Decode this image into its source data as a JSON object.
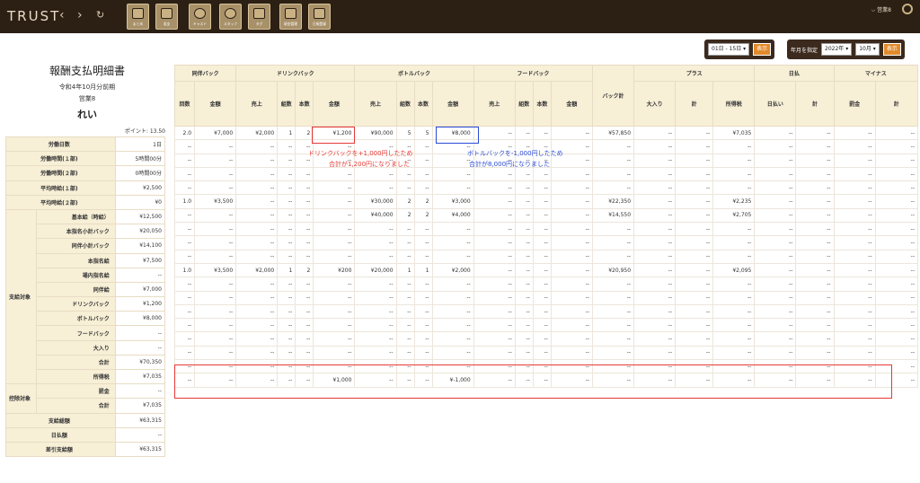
{
  "header": {
    "logo": "TRUST",
    "back": "‹",
    "forward": "›",
    "reload": "↻",
    "tools": [
      {
        "label": "まとめ",
        "icon": "clipboard-icon"
      },
      {
        "label": "収支",
        "icon": "bar-chart-icon"
      },
      {
        "label": "キャスト",
        "icon": "cast-user-icon"
      },
      {
        "label": "スタッフ",
        "icon": "staff-user-icon"
      },
      {
        "label": "タグ",
        "icon": "pencil-icon"
      },
      {
        "label": "現金管理",
        "icon": "cash-icon"
      },
      {
        "label": "日報登録",
        "icon": "calendar-icon"
      }
    ],
    "user": "営業8"
  },
  "controls": {
    "period": "01日 - 15日",
    "show1": "表示",
    "label": "年月を指定",
    "year": "2022年",
    "month": "10月",
    "show2": "表示"
  },
  "left": {
    "title": "報酬支払明細書",
    "period": "令和4年10月分前期",
    "dept": "営業8",
    "name": "れい",
    "points": "ポイント: 13.50",
    "rows": [
      {
        "group": "",
        "label": "労働日数",
        "value": "1日"
      },
      {
        "group": "",
        "label": "労働時間(１部)",
        "value": "5時間00分"
      },
      {
        "group": "",
        "label": "労働時間(２部)",
        "value": "0時間00分"
      },
      {
        "group": "",
        "label": "平均時給(１部)",
        "value": "¥2,500"
      },
      {
        "group": "",
        "label": "平均時給(２部)",
        "value": "¥0"
      },
      {
        "group": "",
        "label": "基本給（時給）",
        "value": "¥12,500"
      },
      {
        "group": "",
        "label": "本指名小計バック",
        "value": "¥20,050"
      },
      {
        "group": "",
        "label": "同伴小計バック",
        "value": "¥14,100"
      },
      {
        "group": "",
        "label": "本指名給",
        "value": "¥7,500"
      },
      {
        "group": "",
        "label": "場内指名給",
        "value": "--"
      },
      {
        "group": "支給対象",
        "label": "同伴給",
        "value": "¥7,000"
      },
      {
        "group": "",
        "label": "ドリンクバック",
        "value": "¥1,200"
      },
      {
        "group": "",
        "label": "ボトルバック",
        "value": "¥8,000"
      },
      {
        "group": "",
        "label": "フードバック",
        "value": "--"
      },
      {
        "group": "",
        "label": "大入り",
        "value": "--"
      },
      {
        "group": "",
        "label": "合計",
        "value": "¥70,350"
      },
      {
        "group": "",
        "label": "所得税",
        "value": "¥7,035"
      },
      {
        "group": "控除対象",
        "label": "罰金",
        "value": "--"
      },
      {
        "group": "",
        "label": "合計",
        "value": "¥7,035"
      },
      {
        "group": "",
        "label": "支給総額",
        "value": "¥63,315"
      },
      {
        "group": "",
        "label": "日払額",
        "value": "--"
      },
      {
        "group": "",
        "label": "差引支給額",
        "value": "¥63,315"
      }
    ]
  },
  "table": {
    "groups": [
      "同伴バック",
      "ドリンクバック",
      "ボトルバック",
      "フードバック",
      "",
      "プラス",
      "日払",
      "マイナス"
    ],
    "columns": [
      "回数",
      "金額",
      "売上",
      "組数",
      "本数",
      "金額",
      "売上",
      "組数",
      "本数",
      "金額",
      "売上",
      "組数",
      "本数",
      "金額",
      "バック計",
      "大入り",
      "計",
      "所得税",
      "日払い",
      "計",
      "罰金",
      "計"
    ],
    "rows": [
      [
        "2.0",
        "¥7,000",
        "¥2,000",
        "1",
        "2",
        "¥1,200",
        "¥90,000",
        "5",
        "5",
        "¥8,000",
        "--",
        "--",
        "--",
        "--",
        "¥57,850",
        "--",
        "--",
        "¥7,035",
        "--",
        "--",
        "--",
        "--"
      ],
      [
        "--",
        "--",
        "--",
        "--",
        "--",
        "--",
        "--",
        "--",
        "--",
        "--",
        "--",
        "--",
        "--",
        "--",
        "--",
        "--",
        "--",
        "--",
        "--",
        "--",
        "--",
        "--"
      ],
      [
        "--",
        "--",
        "--",
        "--",
        "--",
        "--",
        "--",
        "--",
        "--",
        "--",
        "--",
        "--",
        "--",
        "--",
        "--",
        "--",
        "--",
        "--",
        "--",
        "--",
        "--",
        "--"
      ],
      [
        "--",
        "--",
        "--",
        "--",
        "--",
        "--",
        "--",
        "--",
        "--",
        "--",
        "--",
        "--",
        "--",
        "--",
        "--",
        "--",
        "--",
        "--",
        "--",
        "--",
        "--",
        "--"
      ],
      [
        "--",
        "--",
        "--",
        "--",
        "--",
        "--",
        "--",
        "--",
        "--",
        "--",
        "--",
        "--",
        "--",
        "--",
        "--",
        "--",
        "--",
        "--",
        "--",
        "--",
        "--",
        "--"
      ],
      [
        "1.0",
        "¥3,500",
        "--",
        "--",
        "--",
        "--",
        "¥30,000",
        "2",
        "2",
        "¥3,000",
        "--",
        "--",
        "--",
        "--",
        "¥22,350",
        "--",
        "--",
        "¥2,235",
        "--",
        "--",
        "--",
        "--"
      ],
      [
        "--",
        "--",
        "--",
        "--",
        "--",
        "--",
        "¥40,000",
        "2",
        "2",
        "¥4,000",
        "--",
        "--",
        "--",
        "--",
        "¥14,550",
        "--",
        "--",
        "¥2,705",
        "--",
        "--",
        "--",
        "--"
      ],
      [
        "--",
        "--",
        "--",
        "--",
        "--",
        "--",
        "--",
        "--",
        "--",
        "--",
        "--",
        "--",
        "--",
        "--",
        "--",
        "--",
        "--",
        "--",
        "--",
        "--",
        "--",
        "--"
      ],
      [
        "--",
        "--",
        "--",
        "--",
        "--",
        "--",
        "--",
        "--",
        "--",
        "--",
        "--",
        "--",
        "--",
        "--",
        "--",
        "--",
        "--",
        "--",
        "--",
        "--",
        "--",
        "--"
      ],
      [
        "--",
        "--",
        "--",
        "--",
        "--",
        "--",
        "--",
        "--",
        "--",
        "--",
        "--",
        "--",
        "--",
        "--",
        "--",
        "--",
        "--",
        "--",
        "--",
        "--",
        "--",
        "--"
      ],
      [
        "1.0",
        "¥3,500",
        "¥2,000",
        "1",
        "2",
        "¥200",
        "¥20,000",
        "1",
        "1",
        "¥2,000",
        "--",
        "--",
        "--",
        "--",
        "¥20,950",
        "--",
        "--",
        "¥2,095",
        "--",
        "--",
        "--",
        "--"
      ],
      [
        "--",
        "--",
        "--",
        "--",
        "--",
        "--",
        "--",
        "--",
        "--",
        "--",
        "--",
        "--",
        "--",
        "--",
        "--",
        "--",
        "--",
        "--",
        "--",
        "--",
        "--",
        "--"
      ],
      [
        "--",
        "--",
        "--",
        "--",
        "--",
        "--",
        "--",
        "--",
        "--",
        "--",
        "--",
        "--",
        "--",
        "--",
        "--",
        "--",
        "--",
        "--",
        "--",
        "--",
        "--",
        "--"
      ],
      [
        "--",
        "--",
        "--",
        "--",
        "--",
        "--",
        "--",
        "--",
        "--",
        "--",
        "--",
        "--",
        "--",
        "--",
        "--",
        "--",
        "--",
        "--",
        "--",
        "--",
        "--",
        "--"
      ],
      [
        "--",
        "--",
        "--",
        "--",
        "--",
        "--",
        "--",
        "--",
        "--",
        "--",
        "--",
        "--",
        "--",
        "--",
        "--",
        "--",
        "--",
        "--",
        "--",
        "--",
        "--",
        "--"
      ],
      [
        "--",
        "--",
        "--",
        "--",
        "--",
        "--",
        "--",
        "--",
        "--",
        "--",
        "--",
        "--",
        "--",
        "--",
        "--",
        "--",
        "--",
        "--",
        "--",
        "--",
        "--",
        "--"
      ],
      [
        "--",
        "--",
        "--",
        "--",
        "--",
        "--",
        "--",
        "--",
        "--",
        "--",
        "--",
        "--",
        "--",
        "--",
        "--",
        "--",
        "--",
        "--",
        "--",
        "--",
        "--",
        "--"
      ],
      [
        "--",
        "--",
        "--",
        "--",
        "--",
        "--",
        "--",
        "--",
        "--",
        "--",
        "--",
        "--",
        "--",
        "--",
        "--",
        "--",
        "--",
        "--",
        "--",
        "--",
        "--",
        "--"
      ]
    ],
    "adjust": [
      "--",
      "--",
      "--",
      "--",
      "--",
      "¥1,000",
      "--",
      "--",
      "--",
      "¥-1,000",
      "--",
      "--",
      "--",
      "--",
      "--",
      "--",
      "--",
      "--",
      "--",
      "--",
      "--",
      "--"
    ]
  },
  "annotations": {
    "red": [
      "ドリンクバックを+1,000円したため",
      "合計が1,200円になりました"
    ],
    "blue": [
      "ボトルバックを-1,000円したため",
      "合計が8,000円になりました"
    ]
  },
  "colors": {
    "header_bg": "#2c2014",
    "red": "#e53935",
    "blue": "#2a4bd7",
    "pink": "#fbe2d4",
    "tan": "#f7efd6"
  }
}
